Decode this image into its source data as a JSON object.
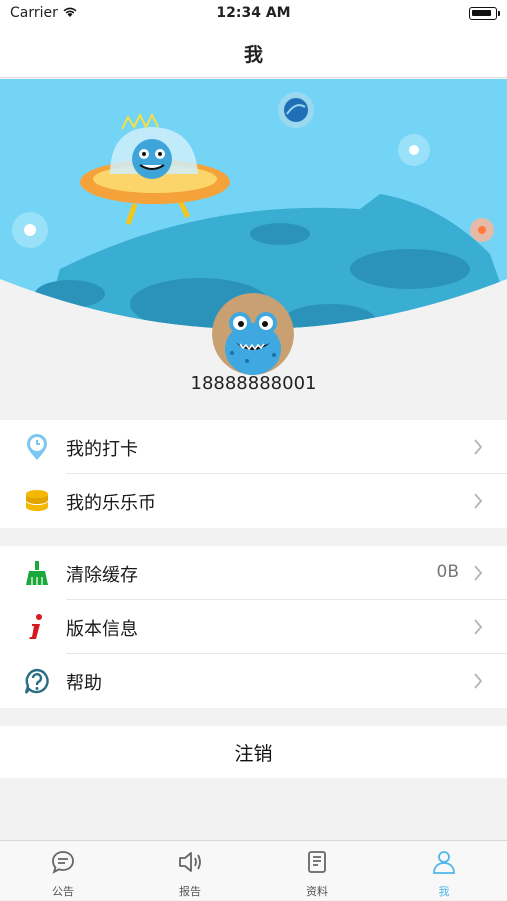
{
  "status_bar": {
    "carrier": "Carrier",
    "time": "12:34 AM"
  },
  "nav": {
    "title": "我"
  },
  "profile": {
    "phone": "18888888001"
  },
  "group1": [
    {
      "label": "我的打卡",
      "icon": "clock-pin-icon"
    },
    {
      "label": "我的乐乐币",
      "icon": "coin-stack-icon"
    }
  ],
  "group2": [
    {
      "label": "清除缓存",
      "value": "0B",
      "icon": "broom-icon"
    },
    {
      "label": "版本信息",
      "icon": "info-icon"
    },
    {
      "label": "帮助",
      "icon": "help-icon"
    }
  ],
  "logout_label": "注销",
  "tabs": [
    {
      "label": "公告",
      "icon": "chat-bubble-icon"
    },
    {
      "label": "报告",
      "icon": "speaker-icon"
    },
    {
      "label": "资料",
      "icon": "document-icon"
    },
    {
      "label": "我",
      "icon": "person-icon",
      "active": true
    }
  ],
  "colors": {
    "accent": "#4cb8e8",
    "sky": "#6fd3f5",
    "planet": "#3fb5d8"
  }
}
